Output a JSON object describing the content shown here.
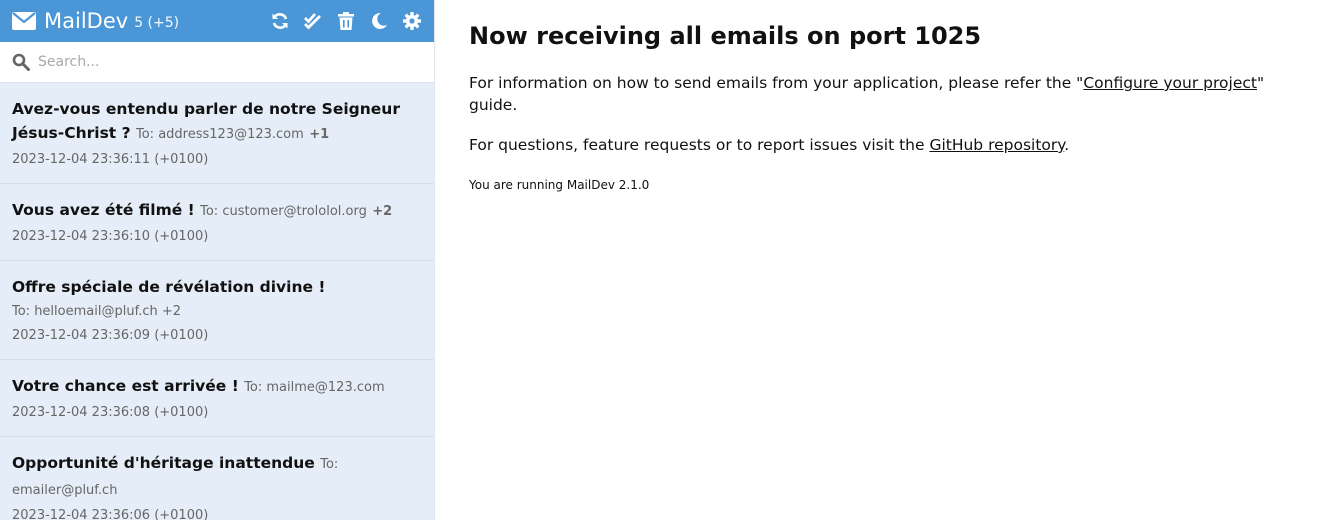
{
  "app": {
    "title": "MailDev",
    "count": "5 (+5)"
  },
  "toolbar": {
    "icons": [
      "refresh-icon",
      "mark-all-read-icon",
      "trash-icon",
      "dark-mode-icon",
      "settings-icon"
    ]
  },
  "search": {
    "placeholder": "Search..."
  },
  "emails": [
    {
      "subject": "Avez-vous entendu parler de notre Seigneur Jésus-Christ ?",
      "to": "To: address123@123.com",
      "extra": "+1",
      "date": "2023-12-04 23:36:11 (+0100)"
    },
    {
      "subject": "Vous avez été filmé !",
      "to": "To: customer@trololol.org",
      "extra": "+2",
      "date": "2023-12-04 23:36:10 (+0100)"
    },
    {
      "subject": "Offre spéciale de révélation divine !",
      "to": "To: helloemail@pluf.ch",
      "extra": "+2",
      "date": "2023-12-04 23:36:09 (+0100)"
    },
    {
      "subject": "Votre chance est arrivée !",
      "to": "To: mailme@123.com",
      "extra": "",
      "date": "2023-12-04 23:36:08 (+0100)"
    },
    {
      "subject": "Opportunité d'héritage inattendue",
      "to": "To: emailer@pluf.ch",
      "extra": "",
      "date": "2023-12-04 23:36:06 (+0100)"
    }
  ],
  "main": {
    "heading": "Now receiving all emails on port 1025",
    "info_prefix": "For information on how to send emails from your application, please refer the \"",
    "info_link": "Configure your project",
    "info_suffix": "\" guide.",
    "questions_prefix": "For questions, feature requests or to report issues visit the ",
    "questions_link": "GitHub repository",
    "questions_suffix": ".",
    "version": "You are running MailDev 2.1.0"
  },
  "colors": {
    "topbar": "#4b96d6",
    "list_bg": "#e5eef8"
  }
}
